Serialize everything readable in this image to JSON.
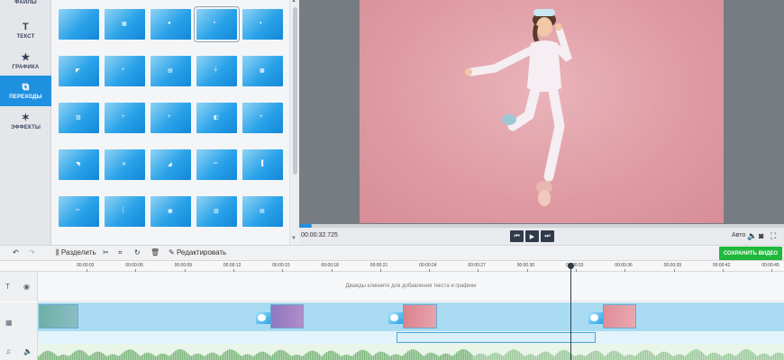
{
  "sidebar": {
    "items": [
      {
        "label": "ФАЙЛЫ",
        "icon": "folder-icon"
      },
      {
        "label": "ТЕКСТ",
        "icon": "text-icon",
        "glyph": "T"
      },
      {
        "label": "ГРАФИКА",
        "icon": "star-icon",
        "glyph": "★"
      },
      {
        "label": "ПЕРЕХОДЫ",
        "icon": "transitions-icon",
        "glyph": "⧉",
        "active": true
      },
      {
        "label": "ЭФФЕКТЫ",
        "icon": "magic-wand-icon",
        "glyph": "✶"
      }
    ]
  },
  "transitions": {
    "count_visible": 25,
    "selected_index": 3
  },
  "player": {
    "timecode": "00:00:32.725",
    "quality": "Авто",
    "progress_fraction": 0.02
  },
  "toolbar": {
    "split_label": "Разделить",
    "edit_label": "Редактировать",
    "save_label": "СОХРАНИТЬ ВИДЕО"
  },
  "ruler": {
    "ticks": [
      "00:00:03",
      "00:00:06",
      "00:00:09",
      "00:00:12",
      "00:00:15",
      "00:00:18",
      "00:00:21",
      "00:00:24",
      "00:00:27",
      "00:00:30",
      "00:00:33",
      "00:00:36",
      "00:00:39",
      "00:00:42",
      "00:00:45"
    ]
  },
  "timeline": {
    "text_track_hint": "Дважды кликните для добавления текста и графики",
    "transition_durations": [
      "2.0",
      "2.0",
      "2.0"
    ]
  },
  "colors": {
    "accent": "#1f8fe0",
    "save": "#1eb83a",
    "photo_bg": "#de9aa3"
  }
}
